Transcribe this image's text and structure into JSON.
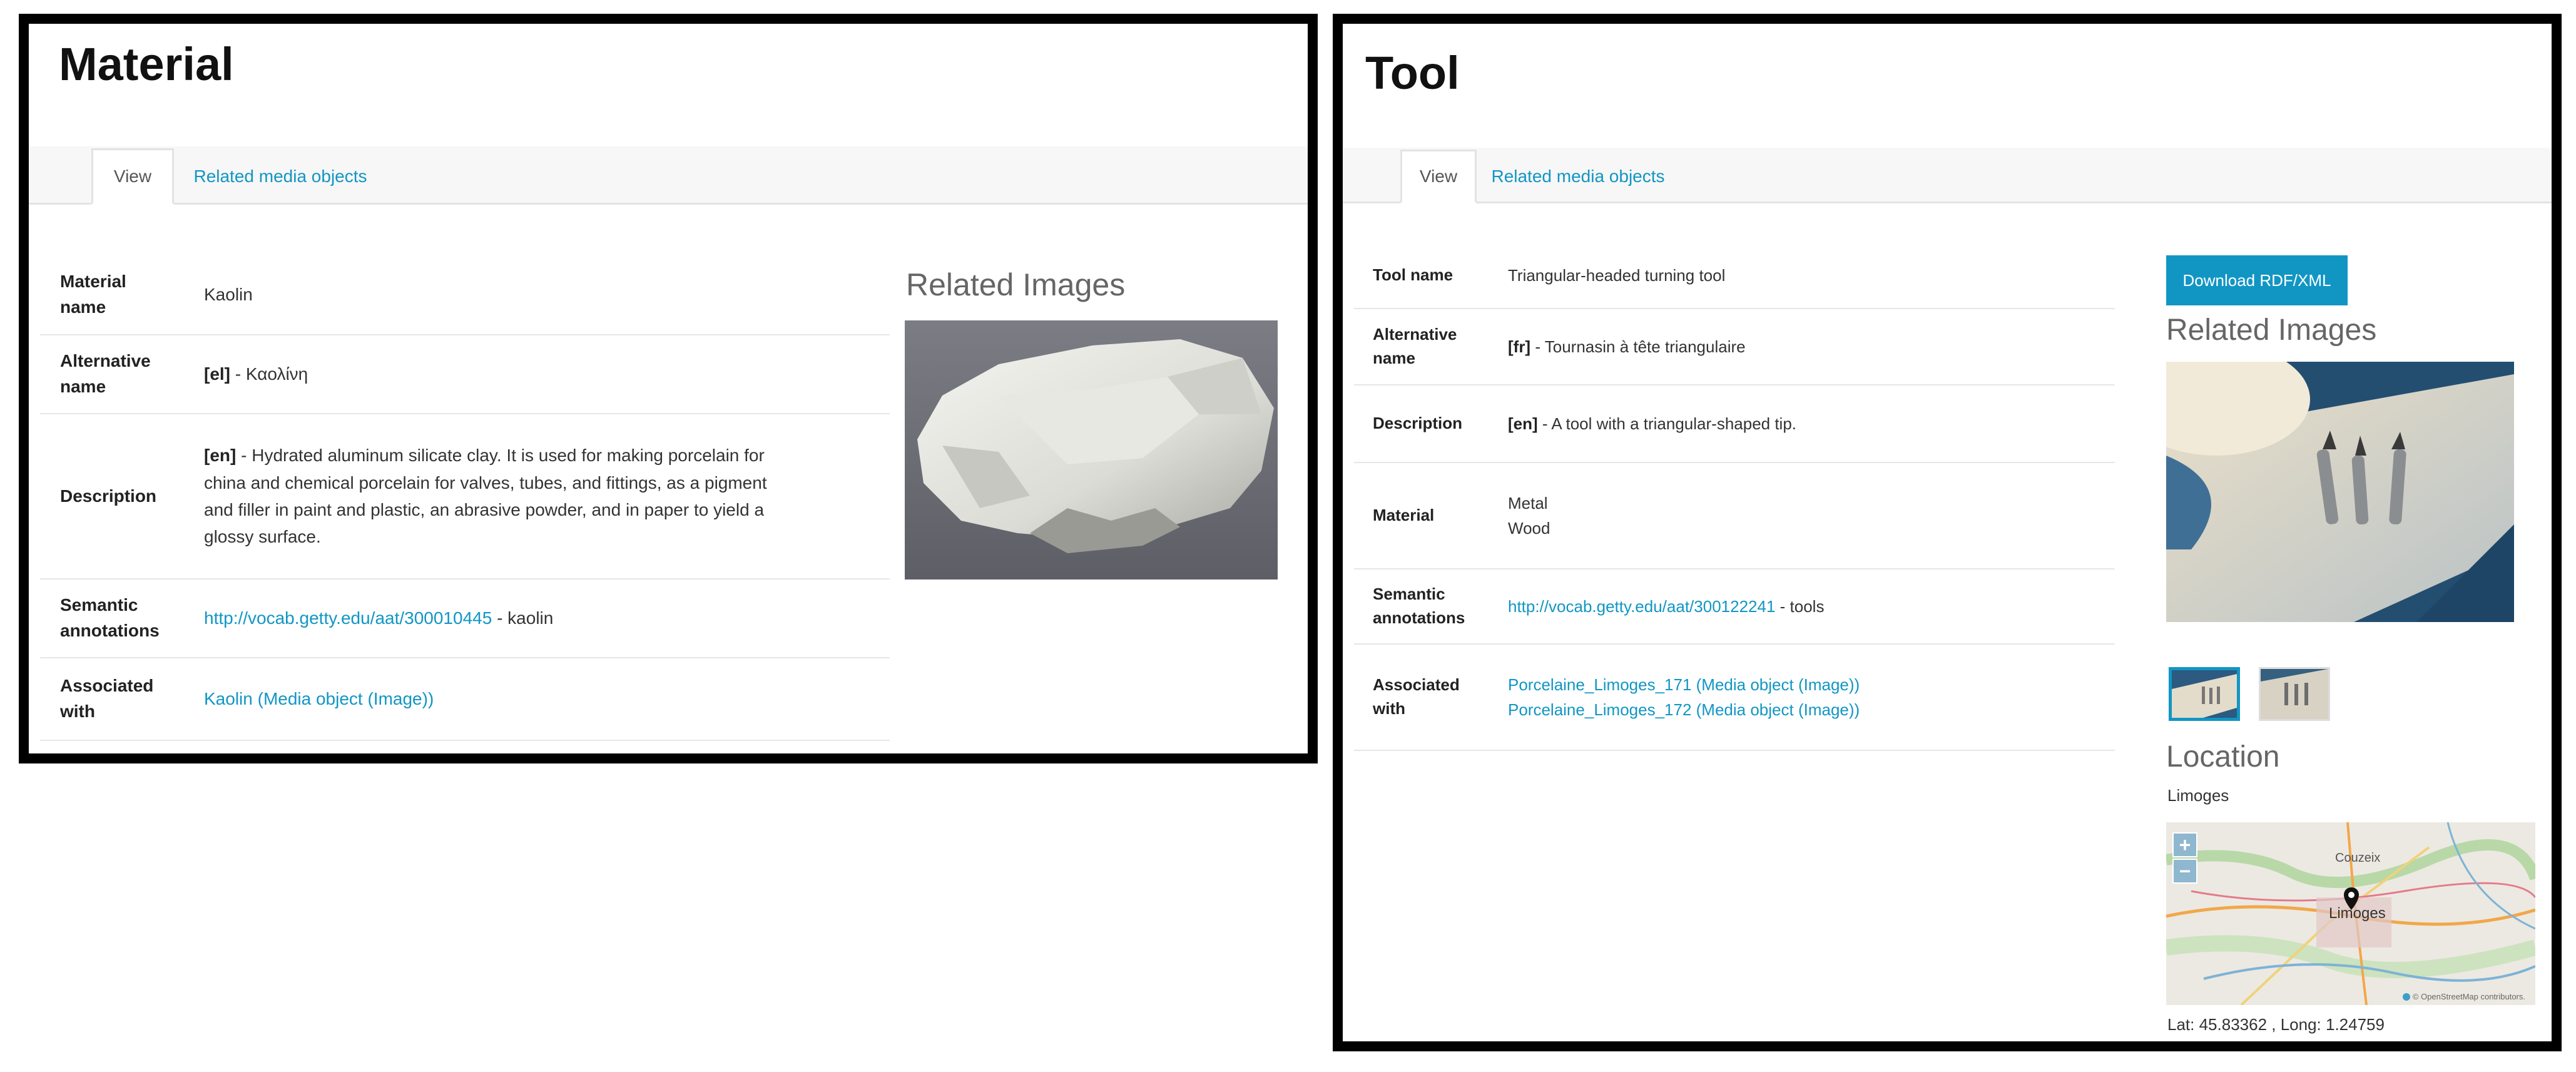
{
  "material_panel": {
    "title": "Material",
    "tabs": {
      "view": "View",
      "related": "Related media objects"
    },
    "properties": {
      "name": {
        "label_1": "Material",
        "label_2": "name",
        "value": "Kaolin"
      },
      "alt_name": {
        "label_1": "Alternative",
        "label_2": "name",
        "lang": "[el]",
        "sep": " - ",
        "value": "Καολίνη"
      },
      "description": {
        "label": "Description",
        "lang": "[en]",
        "sep": " - ",
        "line_1": "Hydrated aluminum silicate clay. It is used for making porcelain for",
        "line_2": "china and chemical porcelain for valves, tubes, and fittings, as a pigment",
        "line_3": "and filler in paint and plastic, an abrasive powder, and in paper to yield a",
        "line_4": "glossy surface."
      },
      "semantic": {
        "label_1": "Semantic",
        "label_2": "annotations",
        "link": "http://vocab.getty.edu/aat/300010445",
        "suffix": " - kaolin"
      },
      "associated": {
        "label_1": "Associated",
        "label_2": "with",
        "link": "Kaolin (Media object (Image))"
      }
    },
    "related_images_heading": "Related Images"
  },
  "tool_panel": {
    "title": "Tool",
    "tabs": {
      "view": "View",
      "related": "Related media objects"
    },
    "properties": {
      "name": {
        "label": "Tool name",
        "value": "Triangular-headed turning tool"
      },
      "alt_name": {
        "label_1": "Alternative",
        "label_2": "name",
        "lang": "[fr]",
        "sep": " - ",
        "value": "Tournasin à tête triangulaire"
      },
      "description": {
        "label": "Description",
        "lang": "[en]",
        "sep": " - ",
        "value": "A tool with a triangular-shaped tip."
      },
      "material": {
        "label": "Material",
        "value_1": "Metal",
        "value_2": "Wood"
      },
      "semantic": {
        "label_1": "Semantic",
        "label_2": "annotations",
        "link": "http://vocab.getty.edu/aat/300122241",
        "suffix": " - tools"
      },
      "associated": {
        "label_1": "Associated",
        "label_2": "with",
        "link_1": "Porcelaine_Limoges_171 (Media object (Image))",
        "link_2": "Porcelaine_Limoges_172 (Media object (Image))"
      }
    },
    "download_button": "Download RDF/XML",
    "related_images_heading": "Related Images",
    "location_heading": "Location",
    "location_name": "Limoges",
    "map": {
      "zoom_in": "+",
      "zoom_out": "−",
      "city_label": "Limoges",
      "town_label": "Couzeix",
      "attribution": "© OpenStreetMap contributors."
    },
    "coordinates": "Lat: 45.83362 , Long: 1.24759"
  },
  "colors": {
    "link": "#1196c4",
    "button": "#1196c4",
    "border": "#000000"
  }
}
